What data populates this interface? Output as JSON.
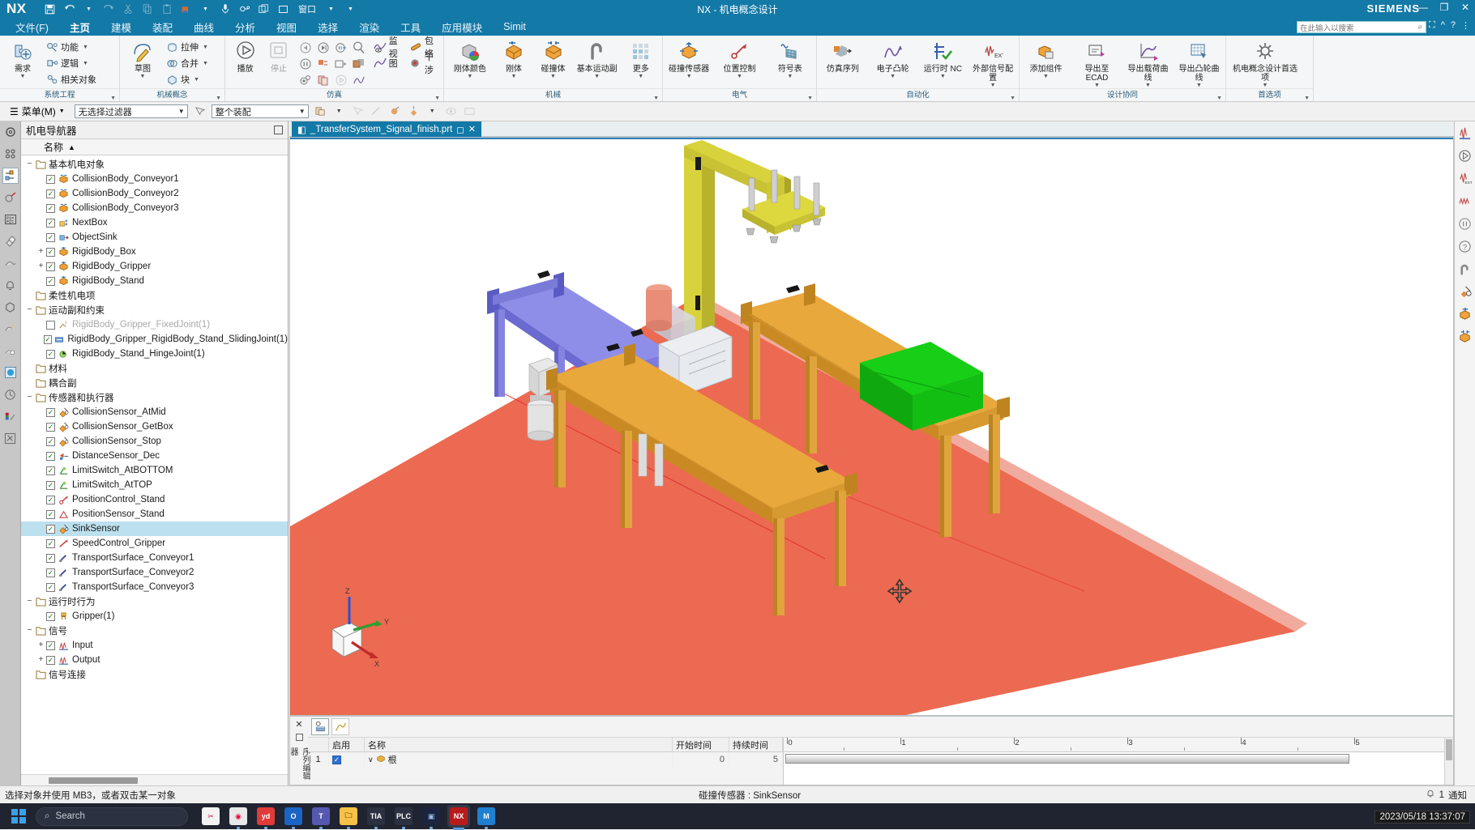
{
  "window": {
    "app_name": "NX",
    "title": "NX - 机电概念设计",
    "brand": "SIEMENS",
    "minimize": "—",
    "restore": "❐",
    "close": "✕"
  },
  "quick_access": [
    {
      "name": "save-icon",
      "glyph": "🖫"
    },
    {
      "name": "undo-icon",
      "glyph": "↶"
    },
    {
      "name": "redo-icon",
      "glyph": "↷"
    },
    {
      "name": "cut-icon",
      "glyph": "✂"
    },
    {
      "name": "copy-icon",
      "glyph": "⧉"
    },
    {
      "name": "paste-icon",
      "glyph": "📋"
    },
    {
      "name": "record-icon",
      "glyph": "⏺"
    },
    {
      "name": "microphone-icon",
      "glyph": "🎤"
    },
    {
      "name": "link-icon",
      "glyph": "🔗"
    },
    {
      "name": "window-icon",
      "glyph": "❑"
    },
    {
      "name": "window-menu-label",
      "glyph": "窗口"
    }
  ],
  "ribbon": {
    "tabs": [
      {
        "label": "文件(F)",
        "active": false
      },
      {
        "label": "主页",
        "active": true
      },
      {
        "label": "建模",
        "active": false
      },
      {
        "label": "装配",
        "active": false
      },
      {
        "label": "曲线",
        "active": false
      },
      {
        "label": "分析",
        "active": false
      },
      {
        "label": "视图",
        "active": false
      },
      {
        "label": "选择",
        "active": false
      },
      {
        "label": "渲染",
        "active": false
      },
      {
        "label": "工具",
        "active": false
      },
      {
        "label": "应用模块",
        "active": false
      },
      {
        "label": "Simit",
        "active": false
      }
    ],
    "search": {
      "placeholder": "在此输入以搜索"
    },
    "groups": [
      {
        "label": "系统工程",
        "big": [
          {
            "label": "需求",
            "icon": "requirement-icon",
            "dropdown": true
          }
        ],
        "small": [
          {
            "label": "功能",
            "icon": "function-icon",
            "dropdown": true
          },
          {
            "label": "逻辑",
            "icon": "logic-icon",
            "dropdown": true
          },
          {
            "label": "相关对象",
            "icon": "related-object-icon",
            "dropdown": false
          }
        ]
      },
      {
        "label": "机械概念",
        "big": [
          {
            "label": "草图",
            "icon": "sketch-icon",
            "dropdown": true
          }
        ],
        "small": [
          {
            "label": "拉伸",
            "icon": "extrude-icon",
            "dropdown": true
          },
          {
            "label": "合并",
            "icon": "unite-icon",
            "dropdown": true
          },
          {
            "label": "块",
            "icon": "block-icon",
            "dropdown": true
          }
        ]
      },
      {
        "label": "仿真",
        "big": [
          {
            "label": "播放",
            "icon": "play-icon",
            "dropdown": false
          },
          {
            "label": "停止",
            "icon": "stop-icon",
            "dropdown": false,
            "disabled": true
          }
        ],
        "small": [
          {
            "label": "监视",
            "icon": "monitor-icon",
            "dropdown": false
          },
          {
            "label": "包络",
            "icon": "envelope-icon",
            "dropdown": false
          },
          {
            "label": "图",
            "icon": "graph-icon",
            "dropdown": false
          },
          {
            "label": "干涉",
            "icon": "interference-icon",
            "dropdown": false
          }
        ],
        "grid_icons": [
          "rewind-icon",
          "forward-icon",
          "step-icon",
          "keyframe-icon",
          "pause-icon",
          "record-sim-icon",
          "snapshot-icon",
          "replay-icon",
          "clip-icon",
          "copy-sim-icon"
        ]
      },
      {
        "label": "机械",
        "big": [
          {
            "label": "刚体颜色",
            "icon": "rigid-color-icon",
            "dropdown": true
          },
          {
            "label": "刚体",
            "icon": "rigid-body-icon",
            "dropdown": true
          },
          {
            "label": "碰撞体",
            "icon": "collision-body-icon",
            "dropdown": true
          },
          {
            "label": "基本运动副",
            "icon": "basic-joint-icon",
            "dropdown": true
          },
          {
            "label": "更多",
            "icon": "more-icon",
            "dropdown": true
          }
        ]
      },
      {
        "label": "电气",
        "big": [
          {
            "label": "碰撞传感器",
            "icon": "collision-sensor-icon",
            "dropdown": true
          },
          {
            "label": "位置控制",
            "icon": "position-control-icon",
            "dropdown": true
          },
          {
            "label": "符号表",
            "icon": "symbol-table-icon",
            "dropdown": true
          }
        ]
      },
      {
        "label": "自动化",
        "big": [
          {
            "label": "仿真序列",
            "icon": "simulation-sequence-icon",
            "dropdown": false
          },
          {
            "label": "电子凸轮",
            "icon": "electronic-cam-icon",
            "dropdown": true
          },
          {
            "label": "运行时 NC",
            "icon": "runtime-nc-icon",
            "dropdown": true
          },
          {
            "label": "外部信号配置",
            "icon": "external-signal-icon",
            "dropdown": true
          }
        ]
      },
      {
        "label": "设计协同",
        "big": [
          {
            "label": "添加组件",
            "icon": "add-component-icon",
            "dropdown": true
          },
          {
            "label": "导出至 ECAD",
            "icon": "export-ecad-icon",
            "dropdown": true
          },
          {
            "label": "导出载荷曲线",
            "icon": "export-load-curve-icon",
            "dropdown": true
          },
          {
            "label": "导出凸轮曲线",
            "icon": "export-cam-curve-icon",
            "dropdown": true
          }
        ]
      },
      {
        "label": "首选项",
        "big": [
          {
            "label": "机电概念设计首选项",
            "icon": "mcd-preferences-icon",
            "dropdown": true
          }
        ]
      }
    ]
  },
  "toolbar2": {
    "menu_label": "菜单(M)",
    "selection_filter": "无选择过滤器",
    "scope": "整个装配",
    "icons": [
      "snap-point-icon",
      "select-feature-icon",
      "select-face-icon",
      "select-body-icon",
      "select-component-icon",
      "move-icon",
      "hide-icon",
      "show-icon"
    ]
  },
  "navigator": {
    "title": "机电导航器",
    "column_header": "名称",
    "sort_arrow": "▲",
    "tree": [
      {
        "label": "基本机电对象",
        "depth": 0,
        "type": "folder",
        "expander": "−"
      },
      {
        "label": "CollisionBody_Conveyor1",
        "depth": 1,
        "type": "item",
        "icon": "collision-body-icon",
        "checked": true
      },
      {
        "label": "CollisionBody_Conveyor2",
        "depth": 1,
        "type": "item",
        "icon": "collision-body-icon",
        "checked": true
      },
      {
        "label": "CollisionBody_Conveyor3",
        "depth": 1,
        "type": "item",
        "icon": "collision-body-icon",
        "checked": true
      },
      {
        "label": "NextBox",
        "depth": 1,
        "type": "item",
        "icon": "object-source-icon",
        "checked": true
      },
      {
        "label": "ObjectSink",
        "depth": 1,
        "type": "item",
        "icon": "object-sink-icon",
        "checked": true
      },
      {
        "label": "RigidBody_Box",
        "depth": 1,
        "type": "item",
        "icon": "rigid-body-icon",
        "checked": true,
        "expander": "+"
      },
      {
        "label": "RigidBody_Gripper",
        "depth": 1,
        "type": "item",
        "icon": "rigid-body-icon",
        "checked": true,
        "expander": "+"
      },
      {
        "label": "RigidBody_Stand",
        "depth": 1,
        "type": "item",
        "icon": "rigid-body-icon",
        "checked": true
      },
      {
        "label": "柔性机电项",
        "depth": 0,
        "type": "folder"
      },
      {
        "label": "运动副和约束",
        "depth": 0,
        "type": "folder",
        "expander": "−"
      },
      {
        "label": "RigidBody_Gripper_FixedJoint(1)",
        "depth": 1,
        "type": "item",
        "icon": "fixed-joint-icon",
        "checked": false,
        "dimmed": true
      },
      {
        "label": "RigidBody_Gripper_RigidBody_Stand_SlidingJoint(1)",
        "depth": 1,
        "type": "item",
        "icon": "sliding-joint-icon",
        "checked": true
      },
      {
        "label": "RigidBody_Stand_HingeJoint(1)",
        "depth": 1,
        "type": "item",
        "icon": "hinge-joint-icon",
        "checked": true
      },
      {
        "label": "材料",
        "depth": 0,
        "type": "folder"
      },
      {
        "label": "耦合副",
        "depth": 0,
        "type": "folder"
      },
      {
        "label": "传感器和执行器",
        "depth": 0,
        "type": "folder",
        "expander": "−"
      },
      {
        "label": "CollisionSensor_AtMid",
        "depth": 1,
        "type": "item",
        "icon": "collision-sensor-icon",
        "checked": true
      },
      {
        "label": "CollisionSensor_GetBox",
        "depth": 1,
        "type": "item",
        "icon": "collision-sensor-icon",
        "checked": true
      },
      {
        "label": "CollisionSensor_Stop",
        "depth": 1,
        "type": "item",
        "icon": "collision-sensor-icon",
        "checked": true
      },
      {
        "label": "DistanceSensor_Dec",
        "depth": 1,
        "type": "item",
        "icon": "distance-sensor-icon",
        "checked": true
      },
      {
        "label": "LimitSwitch_AtBOTTOM",
        "depth": 1,
        "type": "item",
        "icon": "limit-switch-icon",
        "checked": true
      },
      {
        "label": "LimitSwitch_AtTOP",
        "depth": 1,
        "type": "item",
        "icon": "limit-switch-icon",
        "checked": true
      },
      {
        "label": "PositionControl_Stand",
        "depth": 1,
        "type": "item",
        "icon": "position-control-icon",
        "checked": true
      },
      {
        "label": "PositionSensor_Stand",
        "depth": 1,
        "type": "item",
        "icon": "position-sensor-icon",
        "checked": true
      },
      {
        "label": "SinkSensor",
        "depth": 1,
        "type": "item",
        "icon": "collision-sensor-icon",
        "checked": true,
        "selected": true
      },
      {
        "label": "SpeedControl_Gripper",
        "depth": 1,
        "type": "item",
        "icon": "speed-control-icon",
        "checked": true
      },
      {
        "label": "TransportSurface_Conveyor1",
        "depth": 1,
        "type": "item",
        "icon": "transport-surface-icon",
        "checked": true
      },
      {
        "label": "TransportSurface_Conveyor2",
        "depth": 1,
        "type": "item",
        "icon": "transport-surface-icon",
        "checked": true
      },
      {
        "label": "TransportSurface_Conveyor3",
        "depth": 1,
        "type": "item",
        "icon": "transport-surface-icon",
        "checked": true
      },
      {
        "label": "运行时行为",
        "depth": 0,
        "type": "folder",
        "expander": "−"
      },
      {
        "label": "Gripper(1)",
        "depth": 1,
        "type": "item",
        "icon": "runtime-behavior-icon",
        "checked": true
      },
      {
        "label": "信号",
        "depth": 0,
        "type": "folder",
        "expander": "−"
      },
      {
        "label": "Input",
        "depth": 1,
        "type": "item",
        "icon": "signal-icon",
        "checked": true,
        "expander": "+"
      },
      {
        "label": "Output",
        "depth": 1,
        "type": "item",
        "icon": "signal-icon",
        "checked": true,
        "expander": "+"
      },
      {
        "label": "信号连接",
        "depth": 0,
        "type": "folder"
      }
    ]
  },
  "document": {
    "tab_label": "_TransferSystem_Signal_finish.prt",
    "tab_modified_mark": "◻",
    "tab_close": "✕"
  },
  "viewport": {
    "triad": {
      "x": "X",
      "y": "Y",
      "z": "Z"
    },
    "cursor": "move-cursor-icon"
  },
  "right_toolbar": [
    {
      "name": "signal-adapter-icon",
      "glyph": "⚕"
    },
    {
      "name": "play-sim-icon",
      "glyph": "▷"
    },
    {
      "name": "external-signal-icon",
      "glyph": "⇲"
    },
    {
      "name": "signal-icon",
      "glyph": "∿"
    },
    {
      "name": "pause-icon",
      "glyph": "⏸"
    },
    {
      "name": "help-icon",
      "glyph": "?"
    },
    {
      "name": "basic-joint-icon",
      "glyph": "⌐"
    },
    {
      "name": "collision-sensor-icon",
      "glyph": "✥"
    },
    {
      "name": "rigid-body-icon",
      "glyph": "▣"
    },
    {
      "name": "collision-body-icon",
      "glyph": "▤"
    }
  ],
  "sequence_editor": {
    "close_label": "✕",
    "panel_label": "序列编辑器",
    "toolbar": [
      {
        "name": "sequence-editor-icon",
        "glyph": "⏱"
      },
      {
        "name": "curve-editor-icon",
        "glyph": "∕"
      }
    ],
    "columns": [
      "",
      "启用",
      "名称",
      "开始时间",
      "持续时间"
    ],
    "rows": [
      {
        "num": "1",
        "enabled": true,
        "name": "根",
        "start": "0",
        "duration": "5"
      }
    ],
    "timeline": {
      "ticks": [
        "0",
        "1",
        "2",
        "3",
        "4",
        "5"
      ],
      "add_label": "+"
    }
  },
  "statusbar": {
    "message": "选择对象并使用 MB3，或者双击某一对象",
    "selection_info": "碰撞传感器 : SinkSensor",
    "notification_count": "1",
    "notification_label": "通知",
    "notification_icon": "bell-icon"
  },
  "taskbar": {
    "search_placeholder": "Search",
    "search_icon": "search-icon",
    "start_icon": "windows-start-icon",
    "apps": [
      {
        "name": "snipping-tool",
        "label": "✂",
        "color": "#f3f3f3",
        "text": "#d04",
        "running": false
      },
      {
        "name": "chrome",
        "label": "◉",
        "color": "#e8e8e8",
        "text": "#e04",
        "running": true
      },
      {
        "name": "youdao",
        "label": "yd",
        "color": "#e03a3a",
        "text": "#fff",
        "running": true
      },
      {
        "name": "outlook",
        "label": "O",
        "color": "#1b63c4",
        "text": "#fff",
        "running": true
      },
      {
        "name": "teams",
        "label": "T",
        "color": "#5558af",
        "text": "#fff",
        "running": true
      },
      {
        "name": "file-explorer",
        "label": "🗀",
        "color": "#f6c148",
        "text": "#7a5200",
        "running": true
      },
      {
        "name": "tia-portal-v17",
        "label": "TIA",
        "color": "#2b3140",
        "text": "#fff",
        "running": true
      },
      {
        "name": "plcsim",
        "label": "PLC",
        "color": "#2b3140",
        "text": "#fff",
        "running": true
      },
      {
        "name": "powershell",
        "label": "▣",
        "color": "#1b2540",
        "text": "#9bd",
        "running": true
      },
      {
        "name": "nx",
        "label": "NX",
        "color": "#b81b1b",
        "text": "#fff",
        "running": true,
        "active": true
      },
      {
        "name": "mcd-extra",
        "label": "M",
        "color": "#1f7fd0",
        "text": "#fff",
        "running": true
      }
    ],
    "clock_time": "1:37 PM",
    "tooltip_datetime": "2023/05/18 13:37:07"
  }
}
